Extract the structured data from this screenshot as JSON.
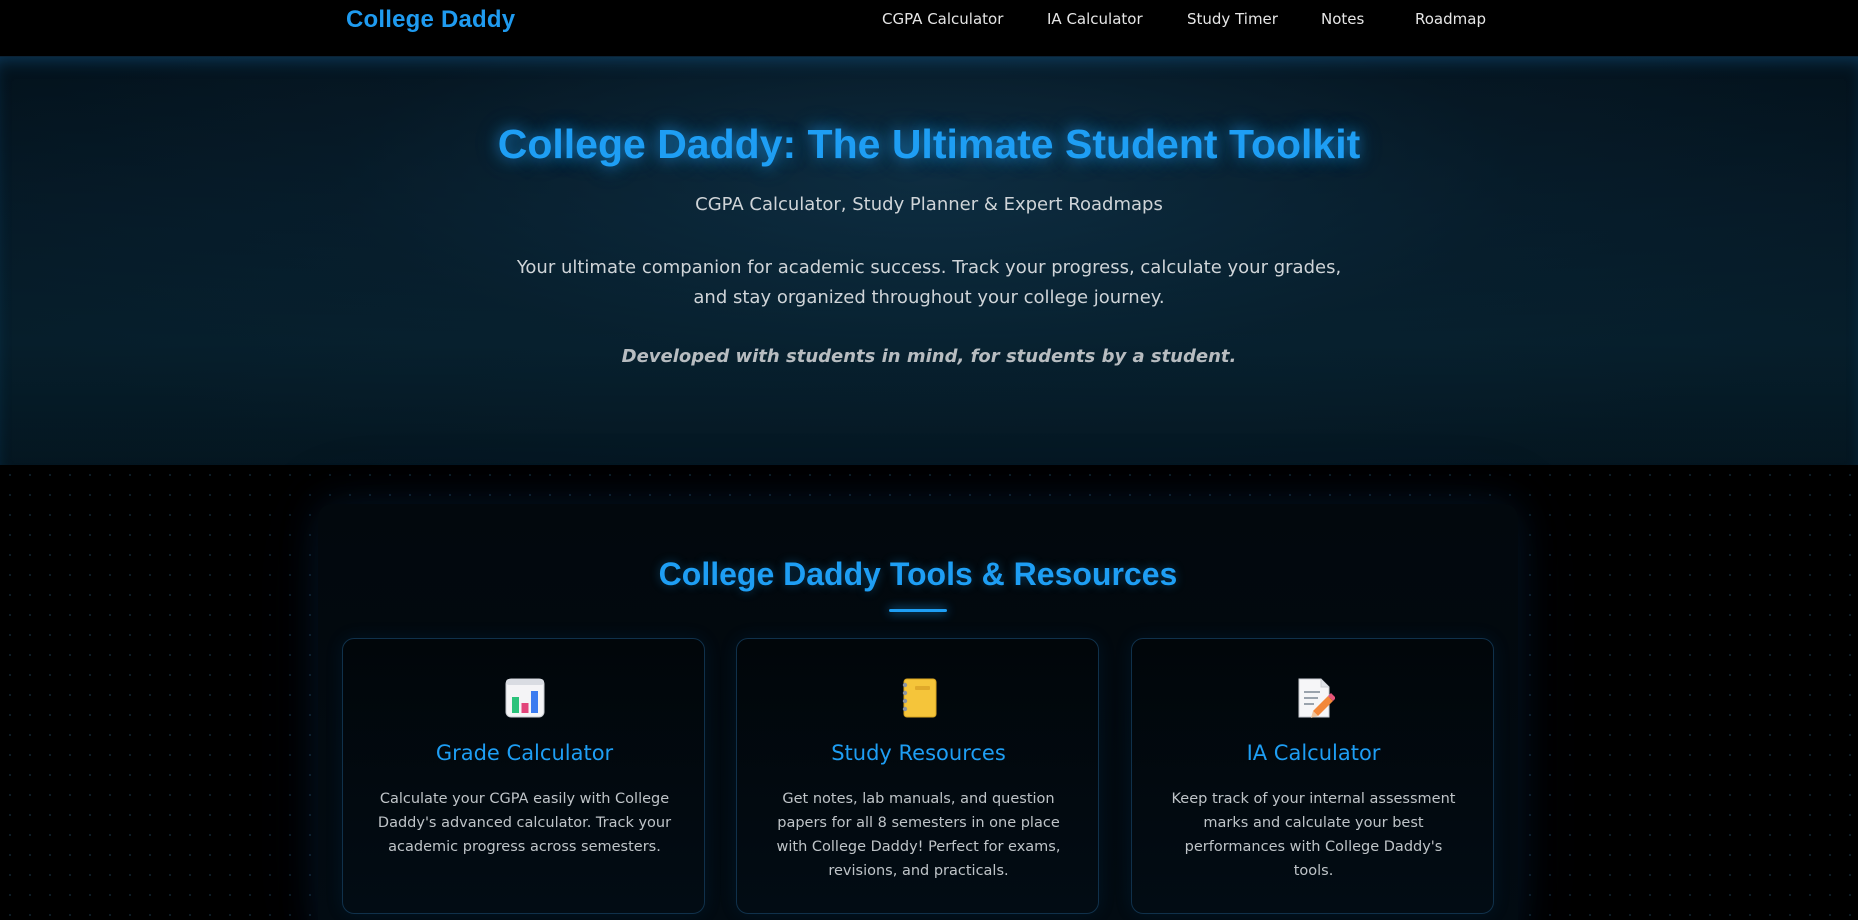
{
  "nav": {
    "logo": "College Daddy",
    "links": [
      "CGPA Calculator",
      "IA Calculator",
      "Study Timer",
      "Notes",
      "Roadmap"
    ]
  },
  "hero": {
    "title": "College Daddy: The Ultimate Student Toolkit",
    "subtitle": "CGPA Calculator, Study Planner & Expert Roadmaps",
    "description": "Your ultimate companion for academic success. Track your progress, calculate your grades, and stay organized throughout your college journey.",
    "tagline": "Developed with students in mind, for students by a student."
  },
  "tools": {
    "title": "College Daddy Tools & Resources",
    "cards": [
      {
        "icon": "bar-chart-icon",
        "title": "Grade Calculator",
        "description": "Calculate your CGPA easily with College Daddy's advanced calculator. Track your academic progress across semesters."
      },
      {
        "icon": "notebook-icon",
        "title": "Study Resources",
        "description": "Get notes, lab manuals, and question papers for all 8 semesters in one place with College Daddy! Perfect for exams, revisions, and practicals."
      },
      {
        "icon": "memo-pencil-icon",
        "title": "IA Calculator",
        "description": "Keep track of your internal assessment marks and calculate your best performances with College Daddy's tools."
      }
    ]
  },
  "colors": {
    "accent": "#1e9ef4",
    "background": "#000000",
    "hero_bg": "#072230",
    "card_border": "#10314b"
  }
}
